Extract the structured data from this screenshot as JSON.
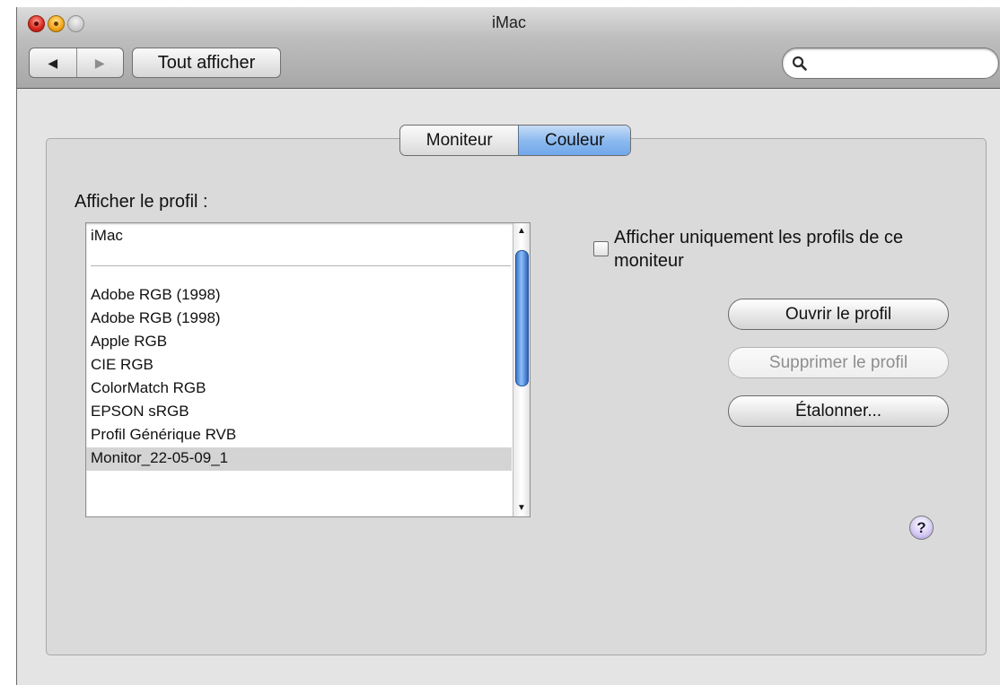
{
  "window": {
    "title": "iMac"
  },
  "toolbar": {
    "back_icon": "◀",
    "forward_icon": "▶",
    "show_all_label": "Tout afficher",
    "search": {
      "value": "",
      "placeholder": ""
    }
  },
  "tabs": [
    {
      "label": "Moniteur",
      "selected": false
    },
    {
      "label": "Couleur",
      "selected": true
    }
  ],
  "profile_section": {
    "label": "Afficher le profil :",
    "current_display": "iMac",
    "profiles": [
      "Adobe RGB (1998)",
      "Adobe RGB (1998)",
      "Apple RGB",
      "CIE RGB",
      "ColorMatch RGB",
      "EPSON  sRGB",
      "Profil Générique RVB",
      "Monitor_22-05-09_1"
    ],
    "selected_profile": "Monitor_22-05-09_1"
  },
  "options": {
    "only_this_monitor_label": "Afficher uniquement les profils de ce moniteur",
    "only_this_monitor_checked": false
  },
  "actions": {
    "open_label": "Ouvrir le profil",
    "delete_label": "Supprimer le profil",
    "calibrate_label": "Étalonner..."
  },
  "help": {
    "label": "?"
  },
  "colors": {
    "window_background": "#e4e4e4",
    "selected_tab": "#8ebbef",
    "scroll_thumb": "#4f86d6",
    "selected_row": "#d4d4d4"
  }
}
